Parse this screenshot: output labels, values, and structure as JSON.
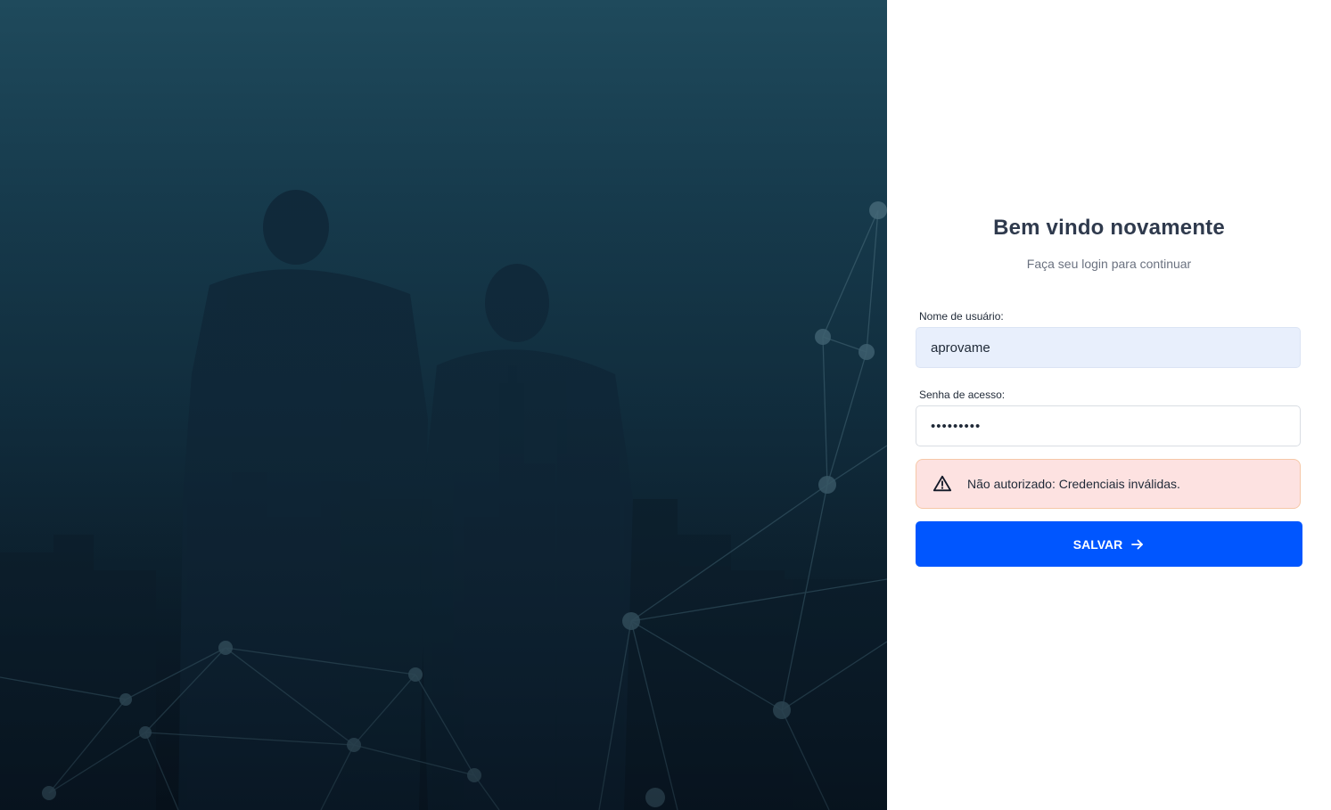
{
  "header": {
    "title": "Bem vindo novamente",
    "subtitle": "Faça seu login para continuar"
  },
  "form": {
    "username_label": "Nome de usuário:",
    "username_value": "aprovame",
    "password_label": "Senha de acesso:",
    "password_value": "•••••••••",
    "submit_label": "SALVAR"
  },
  "alert": {
    "message": "Não autorizado: Credenciais inválidas.",
    "icon": "warning-triangle-icon"
  },
  "colors": {
    "primary_button": "#0056ff",
    "alert_background": "#fde2e1",
    "username_background": "#e8effc",
    "hero_dark": "#08141f"
  },
  "hero": {
    "image": "business-people-city-network-background"
  }
}
